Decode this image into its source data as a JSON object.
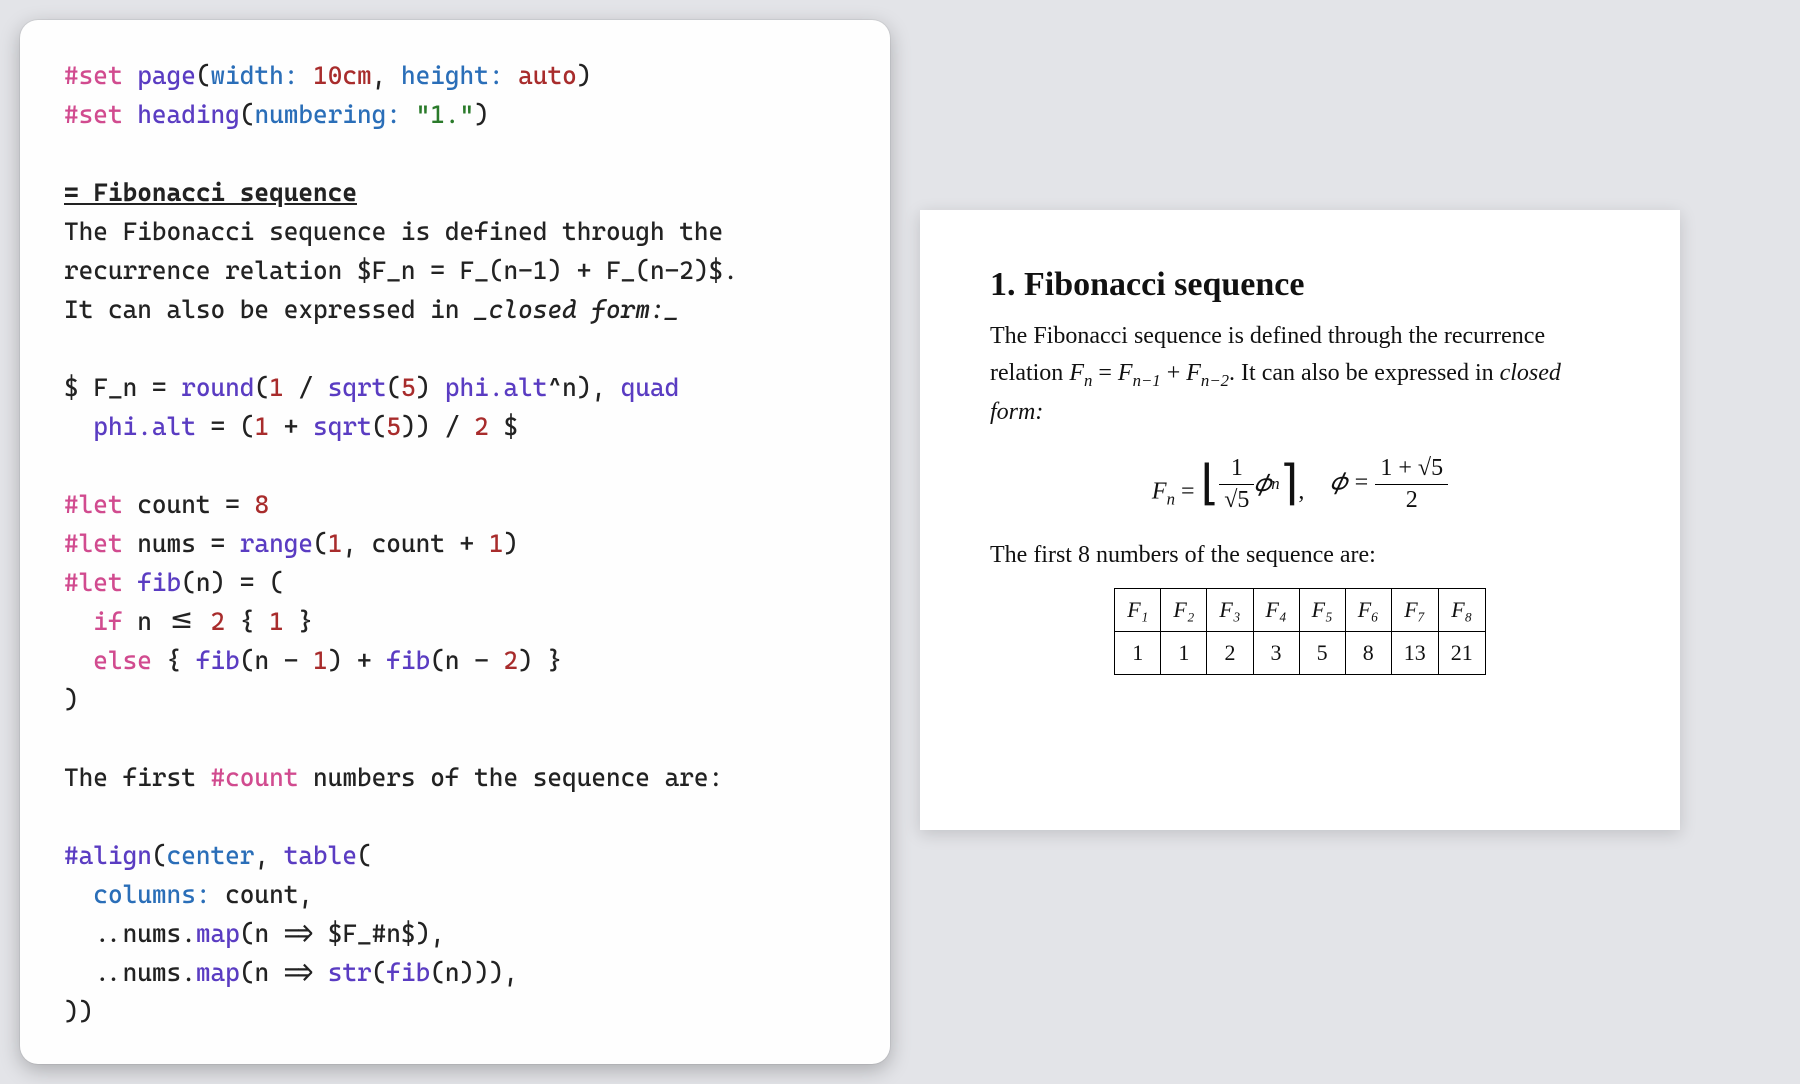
{
  "code": {
    "l1_kw": "#set",
    "l1_fn": "page",
    "l1_a1": "width:",
    "l1_v1": "10cm",
    "l1_a2": "height:",
    "l1_v2": "auto",
    "l2_kw": "#set",
    "l2_fn": "heading",
    "l2_a1": "numbering:",
    "l2_v1": "\"1.\"",
    "l3_head": "= Fibonacci sequence",
    "l4": "The Fibonacci sequence is defined through the",
    "l5a": "recurrence relation ",
    "l5b": "$F_n = F_(n-1) + F_(n-2)$",
    "l5c": ".",
    "l6a": "It can also be expressed in ",
    "l6b": "_closed form:_",
    "l8": "$ F_n = ",
    "l8_fn1": "round",
    "l8_p1": "(",
    "l8_n1": "1",
    "l8_s1": " / ",
    "l8_fn2": "sqrt",
    "l8_p2": "(",
    "l8_n2": "5",
    "l8_p3": ") ",
    "l8_mv": "phi.alt",
    "l8_pw": "^n), ",
    "l8_fn3": "quad",
    "l9_mv": "phi.alt",
    "l9_a": " = (",
    "l9_n1": "1",
    "l9_s1": " + ",
    "l9_fn": "sqrt",
    "l9_p1": "(",
    "l9_n2": "5",
    "l9_p2": ")) / ",
    "l9_n3": "2",
    "l9_end": " $",
    "l11_kw": "#let",
    "l11_var": " count = ",
    "l11_n": "8",
    "l12_kw": "#let",
    "l12_var": " nums = ",
    "l12_fn": "range",
    "l12_p": "(",
    "l12_n1": "1",
    "l12_s": ", count + ",
    "l12_n2": "1",
    "l12_p2": ")",
    "l13_kw": "#let",
    "l13_fn": " fib",
    "l13_sig": "(n) = (",
    "l14_kw": "if",
    "l14_a": " n <= ",
    "l14_n": "2",
    "l14_b": " { ",
    "l14_n2": "1",
    "l14_c": " }",
    "l15_kw": "else",
    "l15_a": " { ",
    "l15_fn": "fib",
    "l15_b": "(n - ",
    "l15_n1": "1",
    "l15_c": ") + ",
    "l15_fn2": "fib",
    "l15_d": "(n - ",
    "l15_n2": "2",
    "l15_e": ") }",
    "l16": ")",
    "l18a": "The first ",
    "l18b": "#count",
    "l18c": " numbers of the sequence are:",
    "l20_fn": "#align",
    "l20_p": "(",
    "l20_arg": "center",
    "l20_s": ", ",
    "l20_fn2": "table",
    "l20_p2": "(",
    "l21_a": "columns:",
    "l21_v": " count,",
    "l22_a": "  ..nums.",
    "l22_fn": "map",
    "l22_b": "(n => ",
    "l22_c": "$F_#n$",
    "l22_d": "),",
    "l23_a": "  ..nums.",
    "l23_fn": "map",
    "l23_b": "(n => ",
    "l23_fn2": "str",
    "l23_c": "(",
    "l23_fn3": "fib",
    "l23_d": "(n))),",
    "l24": "))"
  },
  "preview": {
    "heading": "1. Fibonacci sequence",
    "p1a": "The Fibonacci sequence is defined through the recurrence relation ",
    "p1b": ". It can also be expressed in ",
    "p1c": "closed form:",
    "recur_F": "F",
    "recur_n": "n",
    "recur_eq": " = ",
    "recur_n1": "n−1",
    "recur_plus": " + ",
    "recur_n2": "n−2",
    "eq1_F": "F",
    "eq1_n": "n",
    "eq1_eq": " = ",
    "eq1_fl_l": "⌊",
    "eq1_fl_r": "⌉",
    "eq1_num1": "1",
    "eq1_den1": "√5",
    "eq1_phi": "𝜙",
    "eq1_phin": "n",
    "eq1_comma": ",",
    "eq2_phi": "𝜙 = ",
    "eq2_num": "1 + √5",
    "eq2_den": "2",
    "p2": "The first 8 numbers of the sequence are:",
    "headers": [
      "F₁",
      "F₂",
      "F₃",
      "F₄",
      "F₅",
      "F₆",
      "F₇",
      "F₈"
    ],
    "values": [
      "1",
      "1",
      "2",
      "3",
      "5",
      "8",
      "13",
      "21"
    ]
  }
}
